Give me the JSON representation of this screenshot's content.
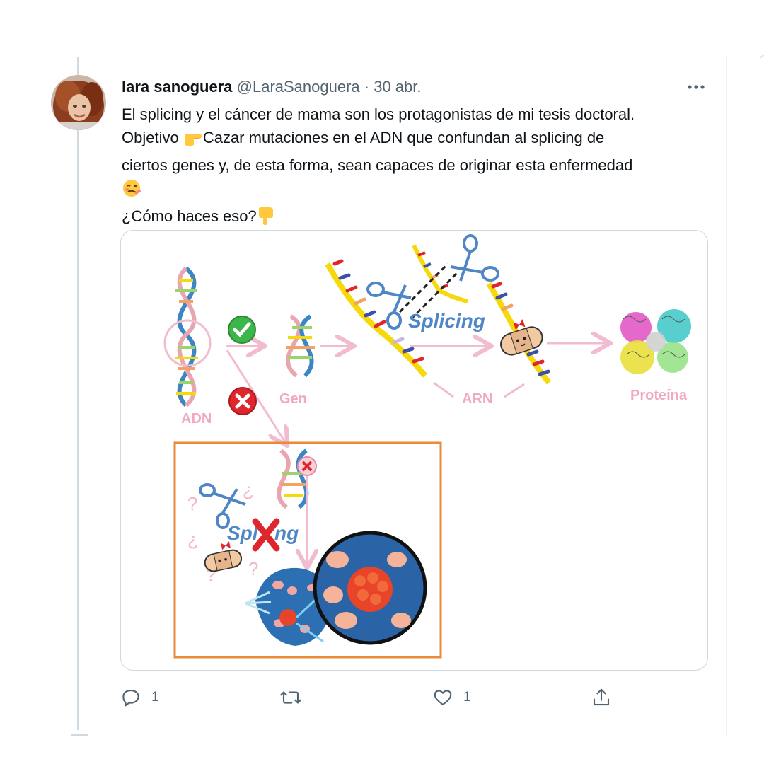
{
  "tweet": {
    "author_name": "lara sanoguera",
    "handle": "@LaraSanoguera",
    "separator": "·",
    "date": "30 abr.",
    "text_line1": "El splicing y el cáncer de mama son los protagonistas de mi tesis doctoral.",
    "text_line2_a": "Objetivo ",
    "text_line2_b": "Cazar mutaciones en el ADN que confundan al splicing de",
    "text_line3": "ciertos genes y, de esta forma, sean capaces de originar esta enfermedad",
    "text_line5": "¿Cómo haces eso?",
    "emojis": [
      "pointing-right-emoji",
      "woozy-face-emoji",
      "pointing-down-emoji"
    ]
  },
  "figure": {
    "labels": {
      "adn": "ADN",
      "gen": "Gen",
      "arn": "ARN",
      "proteina": "Proteína",
      "splicing": "Splicing",
      "splicing_broken_a": "Spl",
      "splicing_broken_b": "ng"
    },
    "colors": {
      "arrow": "#f2bcd0",
      "label_pink": "#f0a9c3",
      "splicing_blue": "#4f86c6",
      "ok_green": "#3cb54a",
      "error_red": "#e0262d",
      "box_orange": "#e88a3a",
      "strand_yellow": "#f5d90a"
    }
  },
  "actions": {
    "reply_count": "1",
    "retweet_count": "",
    "like_count": "1"
  },
  "colors": {
    "text_primary": "#0f1419",
    "text_secondary": "#536471",
    "border": "#cfd9de"
  }
}
